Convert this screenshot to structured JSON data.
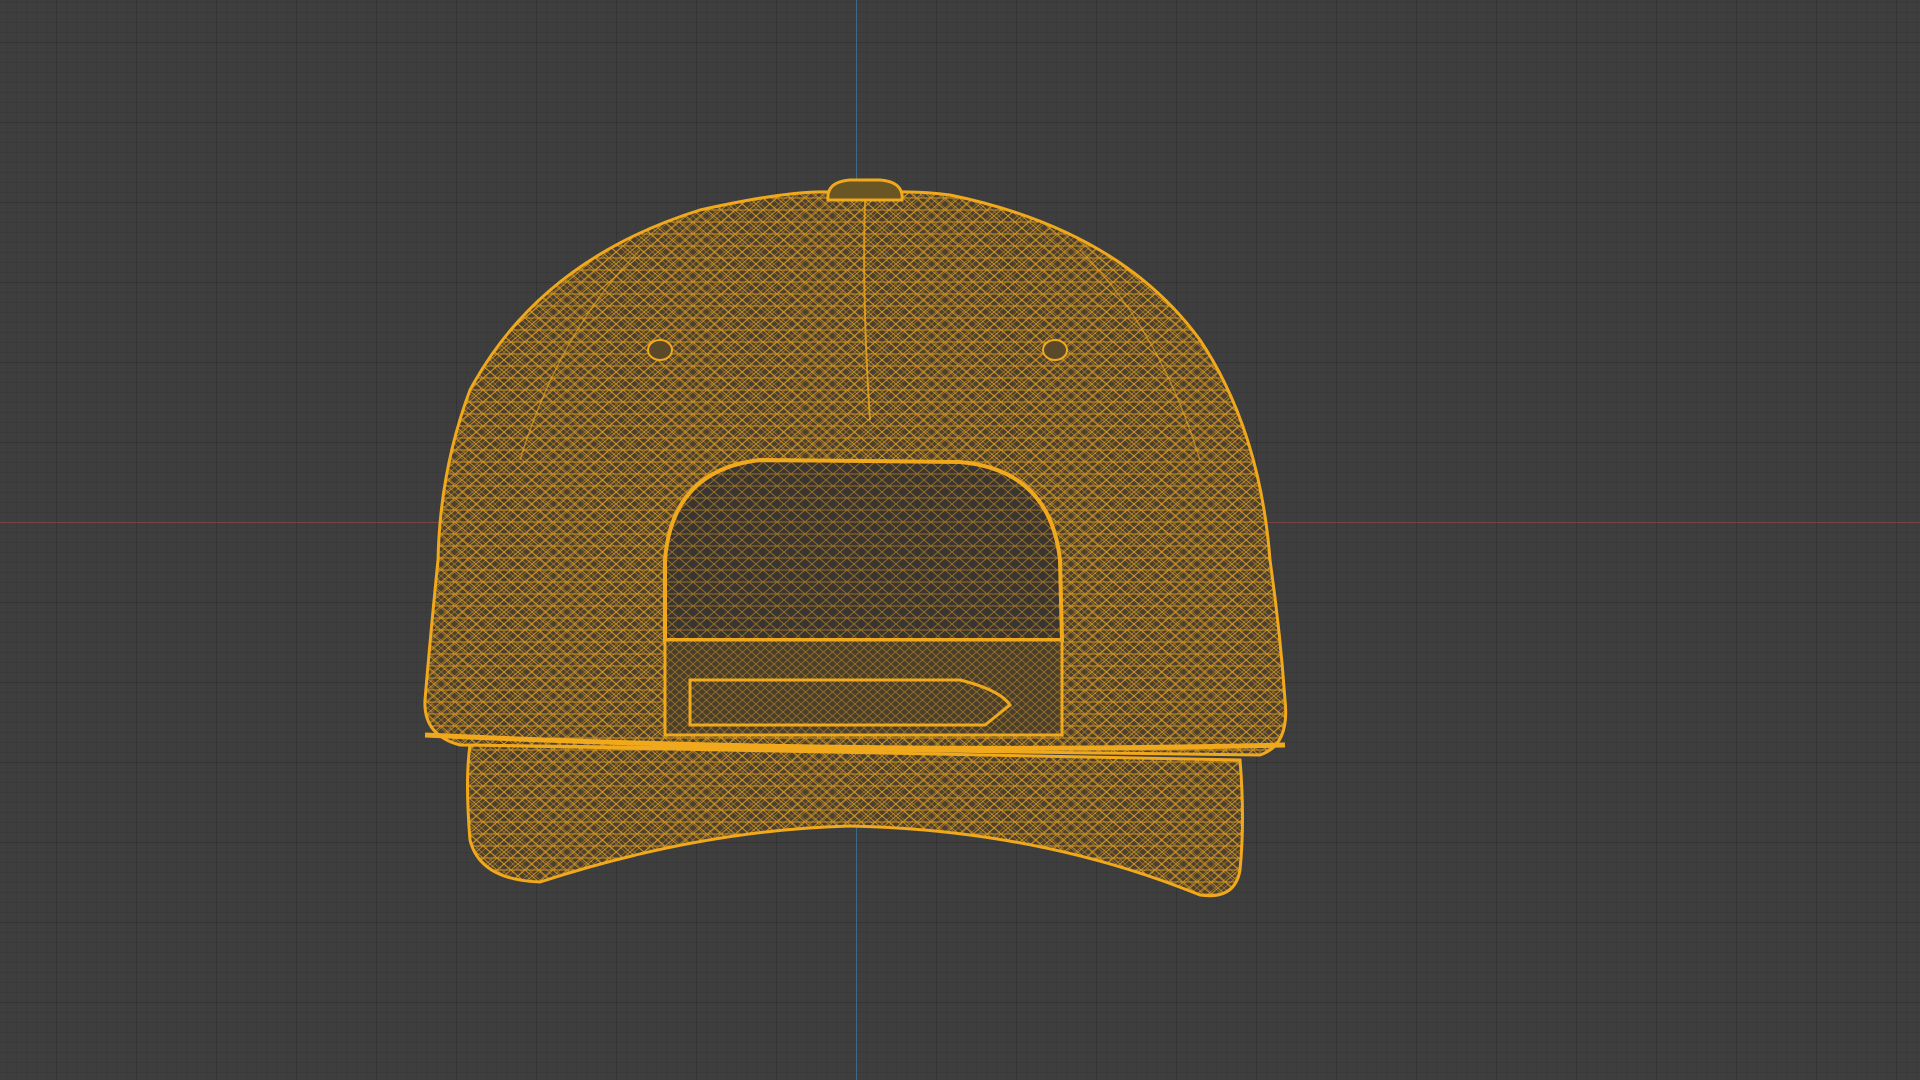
{
  "viewport": {
    "background": "#3e3e3e",
    "x_axis_color": "#7a4447",
    "y_axis_color": "#3f6a86"
  },
  "model": {
    "object": "cap-wireframe-icon",
    "view": "back",
    "display_mode": "wireframe",
    "wire_color": "#f0a81c",
    "shadow_color": "#5a4a2a"
  }
}
